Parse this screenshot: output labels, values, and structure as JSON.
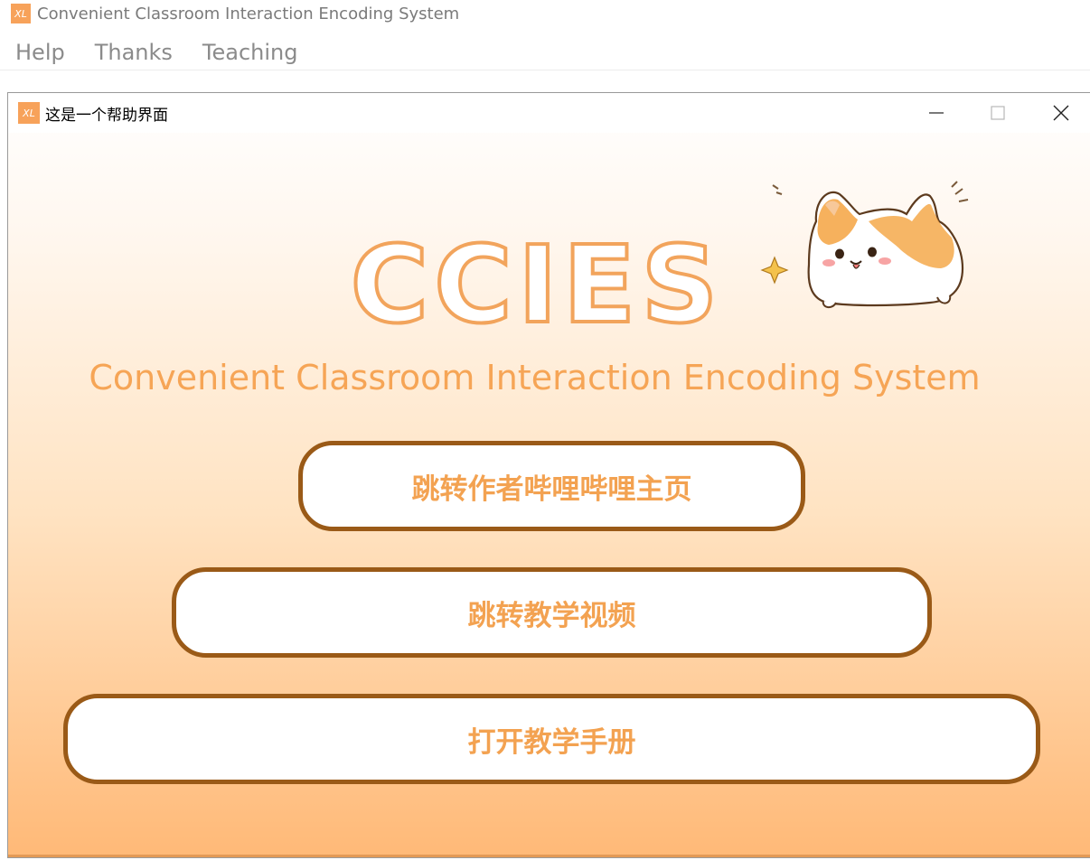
{
  "app": {
    "title": "Convenient Classroom Interaction Encoding System",
    "icon_label": "XL"
  },
  "menu": {
    "items": [
      {
        "label": "Help"
      },
      {
        "label": "Thanks"
      },
      {
        "label": "Teaching"
      }
    ]
  },
  "dialog": {
    "title": "这是一个帮助界面",
    "icon_label": "XL",
    "logo": "CCIES",
    "subtitle": "Convenient Classroom Interaction Encoding System",
    "buttons": {
      "bilibili": "跳转作者哔哩哔哩主页",
      "video": "跳转教学视频",
      "manual": "打开教学手册"
    }
  },
  "colors": {
    "accent": "#f6a556",
    "button_border": "#9a5a17",
    "gradient_bottom": "#ffb977"
  }
}
